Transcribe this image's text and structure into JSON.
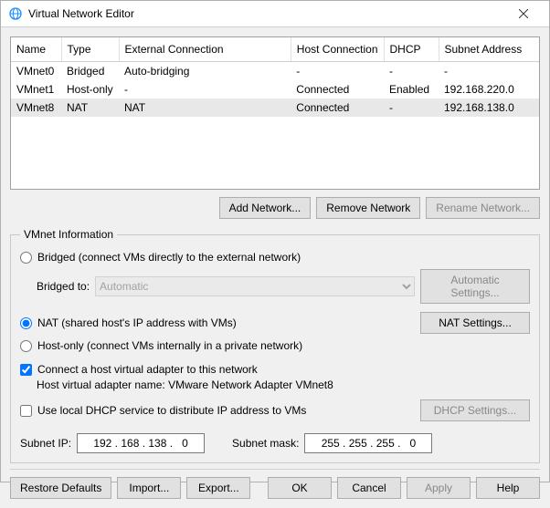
{
  "window": {
    "title": "Virtual Network Editor"
  },
  "table": {
    "headers": {
      "name": "Name",
      "type": "Type",
      "ext": "External Connection",
      "host": "Host Connection",
      "dhcp": "DHCP",
      "subnet": "Subnet Address"
    },
    "rows": [
      {
        "name": "VMnet0",
        "type": "Bridged",
        "ext": "Auto-bridging",
        "host": "-",
        "dhcp": "-",
        "subnet": "-"
      },
      {
        "name": "VMnet1",
        "type": "Host-only",
        "ext": "-",
        "host": "Connected",
        "dhcp": "Enabled",
        "subnet": "192.168.220.0"
      },
      {
        "name": "VMnet8",
        "type": "NAT",
        "ext": "NAT",
        "host": "Connected",
        "dhcp": "-",
        "subnet": "192.168.138.0"
      }
    ]
  },
  "buttons": {
    "add": "Add Network...",
    "remove": "Remove Network",
    "rename": "Rename Network...",
    "auto_settings": "Automatic Settings...",
    "nat_settings": "NAT Settings...",
    "dhcp_settings": "DHCP Settings...",
    "restore": "Restore Defaults",
    "import": "Import...",
    "export": "Export...",
    "ok": "OK",
    "cancel": "Cancel",
    "apply": "Apply",
    "help": "Help"
  },
  "info": {
    "legend": "VMnet Information",
    "bridged_label": "Bridged (connect VMs directly to the external network)",
    "bridged_to_label": "Bridged to:",
    "bridged_to_value": "Automatic",
    "nat_label": "NAT (shared host's IP address with VMs)",
    "hostonly_label": "Host-only (connect VMs internally in a private network)",
    "connect_adapter_label": "Connect a host virtual adapter to this network",
    "host_adapter_name_label": "Host virtual adapter name: VMware Network Adapter VMnet8",
    "use_dhcp_label": "Use local DHCP service to distribute IP address to VMs",
    "subnet_ip_label": "Subnet IP:",
    "subnet_ip_value": "192 . 168 . 138 .   0",
    "subnet_mask_label": "Subnet mask:",
    "subnet_mask_value": "255 . 255 . 255 .   0"
  }
}
